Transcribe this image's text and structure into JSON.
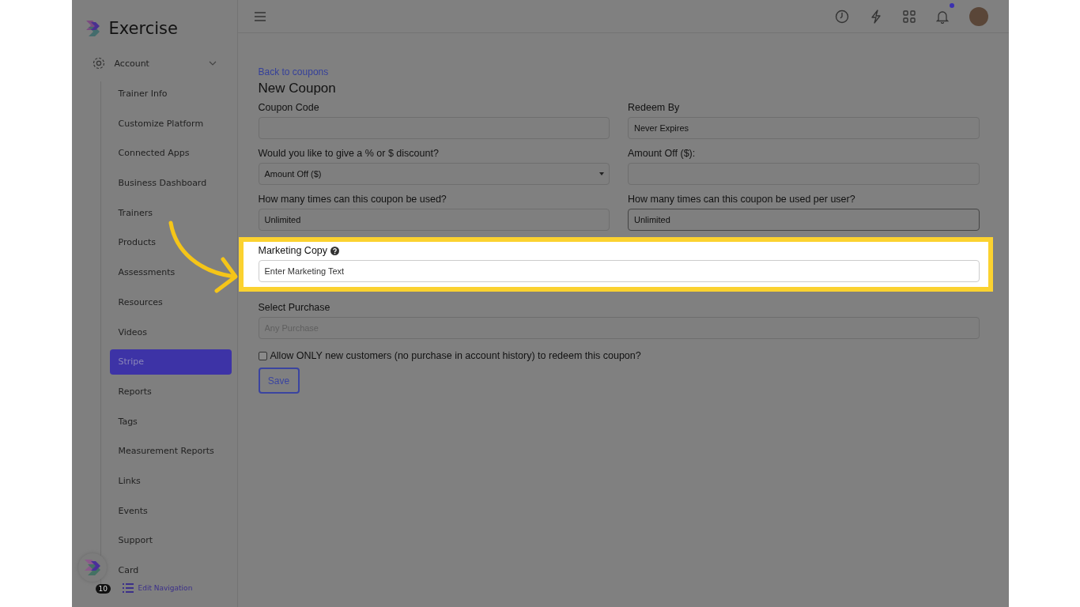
{
  "brand": {
    "name": "Exercise"
  },
  "sidebar": {
    "section": {
      "label": "Account",
      "expanded": true
    },
    "items": [
      {
        "label": "Trainer Info",
        "selected": false
      },
      {
        "label": "Customize Platform",
        "selected": false
      },
      {
        "label": "Connected Apps",
        "selected": false
      },
      {
        "label": "Business Dashboard",
        "selected": false
      },
      {
        "label": "Trainers",
        "selected": false
      },
      {
        "label": "Products",
        "selected": false
      },
      {
        "label": "Assessments",
        "selected": false
      },
      {
        "label": "Resources",
        "selected": false
      },
      {
        "label": "Videos",
        "selected": false
      },
      {
        "label": "Stripe",
        "selected": true
      },
      {
        "label": "Reports",
        "selected": false
      },
      {
        "label": "Tags",
        "selected": false
      },
      {
        "label": "Measurement Reports",
        "selected": false
      },
      {
        "label": "Links",
        "selected": false
      },
      {
        "label": "Events",
        "selected": false
      },
      {
        "label": "Support",
        "selected": false
      },
      {
        "label": "Card",
        "selected": false
      }
    ],
    "launcher_badge": "10",
    "edit_navigation": "Edit Navigation"
  },
  "topbar": {
    "notifications_unread": true
  },
  "form": {
    "back_link": "Back to coupons",
    "title": "New Coupon",
    "fields": [
      {
        "kind": "input",
        "label": "Coupon Code"
      },
      {
        "kind": "input",
        "label": "Redeem By",
        "value": "Never Expires"
      },
      {
        "kind": "select",
        "label": "Would you like to give a % or $ discount?",
        "value": "Amount Off ($)"
      },
      {
        "kind": "input",
        "label": "Amount Off ($):"
      },
      {
        "kind": "input",
        "label": "How many times can this coupon be used?",
        "value": "Unlimited"
      },
      {
        "kind": "input",
        "label": "How many times can this coupon be used per user?",
        "value": "Unlimited",
        "focused": true
      },
      {
        "kind": "wide",
        "label": "Marketing Copy",
        "placeholder": "Enter Marketing Text",
        "help": true,
        "highlighted": true
      },
      {
        "kind": "wide",
        "label": "Select Purchase",
        "placeholder": "Any Purchase",
        "help": false,
        "highlighted": false
      }
    ],
    "new_customers_only": {
      "label": "Allow ONLY new customers (no purchase in account history) to redeem this coupon?",
      "checked": false
    },
    "save": "Save"
  }
}
